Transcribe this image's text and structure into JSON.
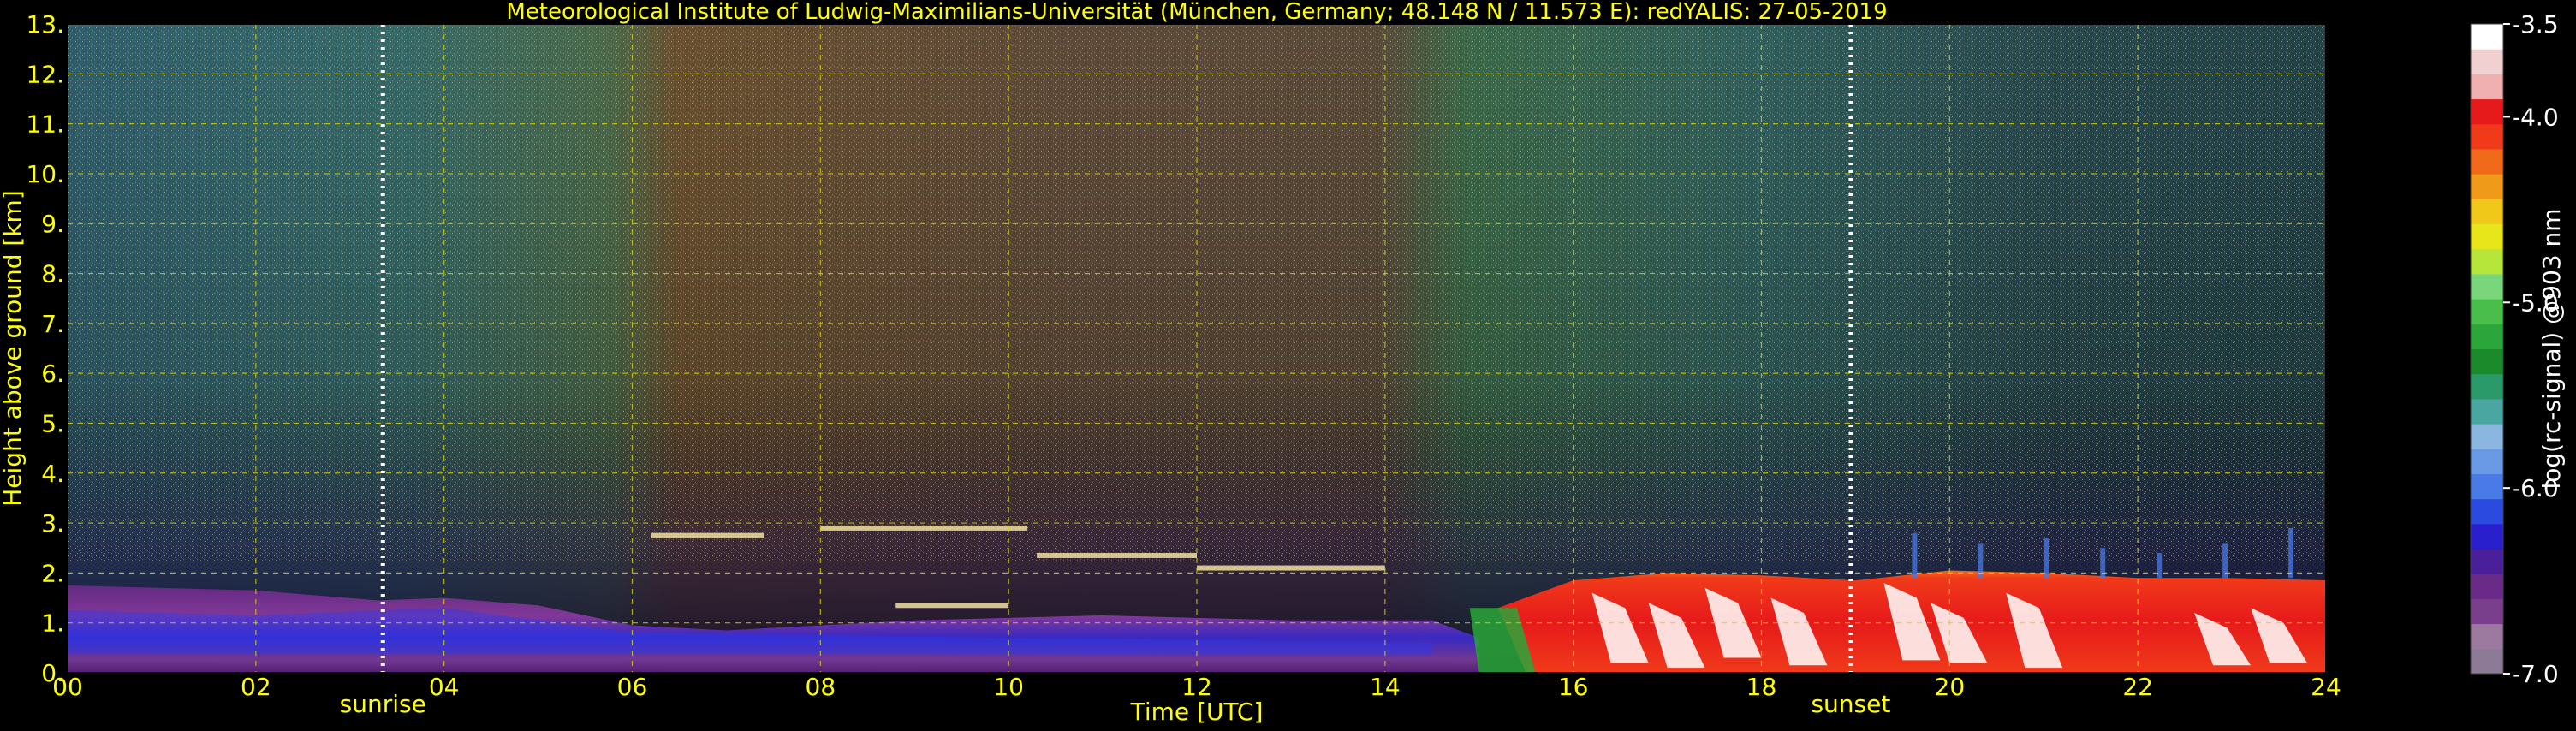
{
  "chart_data": {
    "type": "heatmap",
    "title": "Meteorological Institute of Ludwig-Maximilians-Universität (München, Germany; 48.148 N / 11.573 E):    redYALIS: 27-05-2019",
    "xlabel": "Time [UTC]",
    "ylabel": "Height above ground [km]",
    "xlim": [
      0,
      24
    ],
    "ylim": [
      0,
      13
    ],
    "x_ticks": [
      "00",
      "02",
      "04",
      "06",
      "08",
      "10",
      "12",
      "14",
      "16",
      "18",
      "20",
      "22",
      "24"
    ],
    "y_ticks": [
      "0.",
      "1.",
      "2.",
      "3.",
      "4.",
      "5.",
      "6.",
      "7.",
      "8.",
      "9.",
      "10.",
      "11.",
      "12.",
      "13."
    ],
    "grid": true,
    "grid_color": "#d4d400",
    "text_color": "#ffff00",
    "annotations": [
      {
        "text": "sunrise",
        "x": 3.35
      },
      {
        "text": "sunset",
        "x": 18.95
      }
    ],
    "colorbar": {
      "label": "log(rc-signal) @903 nm",
      "range": [
        -7.0,
        -3.5
      ],
      "ticks": [
        "-3.5",
        "-4.0",
        "-5.0",
        "-6.0",
        "-7.0"
      ],
      "tick_values": [
        -3.5,
        -4.0,
        -5.0,
        -6.0,
        -7.0
      ],
      "colors": [
        "#8c7a96",
        "#9c7aa0",
        "#7a3f8c",
        "#6a2a88",
        "#4a1f9c",
        "#2a1fcc",
        "#2a4ae0",
        "#4a7ae6",
        "#6a9ae6",
        "#8ab6e0",
        "#4aa6a0",
        "#2a9a6a",
        "#1a8a2a",
        "#2aa63a",
        "#4abe4a",
        "#7ad67a",
        "#b6e63a",
        "#e6e61a",
        "#f0c81a",
        "#f09a1a",
        "#f06a1a",
        "#f03a1a",
        "#e61a1a",
        "#f0b0b0",
        "#f0d0d0",
        "#ffffff"
      ]
    },
    "panels": [
      {
        "name": "upper",
        "x_range": [
          0,
          24
        ],
        "y_range": [
          3,
          13
        ],
        "texture": "noise"
      },
      {
        "name": "boundary layer",
        "x_range": [
          0,
          15
        ],
        "y_range": [
          0,
          2
        ]
      },
      {
        "name": "cloud layer",
        "x_range": [
          15,
          24
        ],
        "y_range": [
          0,
          3
        ]
      }
    ]
  }
}
